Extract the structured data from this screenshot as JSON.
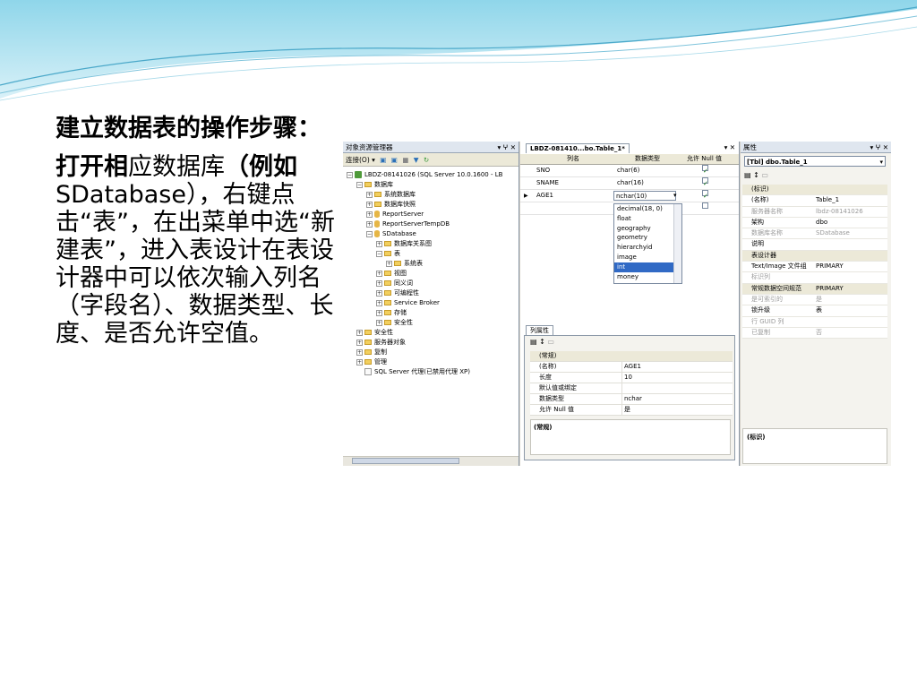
{
  "slide": {
    "heading": "建立数据表的操作步骤：",
    "body_bold_1": "打开相",
    "body_1": "应数据库",
    "body_bold_2": "（例如",
    "body_2": "SDatabase），右键点击“表”，在出菜单中选“新建表”，进入表设计在表设计器中可以依次输入列名（字段名）、数据类型、长度、是否允许空值。"
  },
  "object_explorer": {
    "title": "对象资源管理器",
    "controls": "▾ ⵖ ✕",
    "toolbar_connect": "连接(O) ▾",
    "tree": [
      {
        "label": "LBDZ-08141026 (SQL Server 10.0.1600 - LB",
        "level": 0,
        "pm": "−",
        "icon": "server"
      },
      {
        "label": "数据库",
        "level": 1,
        "pm": "−",
        "icon": "folder"
      },
      {
        "label": "系统数据库",
        "level": 2,
        "pm": "+",
        "icon": "folder"
      },
      {
        "label": "数据库快照",
        "level": 2,
        "pm": "+",
        "icon": "folder"
      },
      {
        "label": "ReportServer",
        "level": 2,
        "pm": "+",
        "icon": "db"
      },
      {
        "label": "ReportServerTempDB",
        "level": 2,
        "pm": "+",
        "icon": "db"
      },
      {
        "label": "SDatabase",
        "level": 2,
        "pm": "−",
        "icon": "db"
      },
      {
        "label": "数据库关系图",
        "level": 3,
        "pm": "+",
        "icon": "folder"
      },
      {
        "label": "表",
        "level": 3,
        "pm": "−",
        "icon": "folder"
      },
      {
        "label": "系统表",
        "level": 4,
        "pm": "+",
        "icon": "folder"
      },
      {
        "label": "视图",
        "level": 3,
        "pm": "+",
        "icon": "folder"
      },
      {
        "label": "同义词",
        "level": 3,
        "pm": "+",
        "icon": "folder"
      },
      {
        "label": "可编程性",
        "level": 3,
        "pm": "+",
        "icon": "folder"
      },
      {
        "label": "Service Broker",
        "level": 3,
        "pm": "+",
        "icon": "folder"
      },
      {
        "label": "存储",
        "level": 3,
        "pm": "+",
        "icon": "folder"
      },
      {
        "label": "安全性",
        "level": 3,
        "pm": "+",
        "icon": "folder"
      },
      {
        "label": "安全性",
        "level": 1,
        "pm": "+",
        "icon": "folder"
      },
      {
        "label": "服务器对象",
        "level": 1,
        "pm": "+",
        "icon": "folder"
      },
      {
        "label": "复制",
        "level": 1,
        "pm": "+",
        "icon": "folder"
      },
      {
        "label": "管理",
        "level": 1,
        "pm": "+",
        "icon": "folder"
      },
      {
        "label": "SQL Server 代理(已禁用代理 XP)",
        "level": 1,
        "pm": "",
        "icon": "agent"
      }
    ]
  },
  "designer": {
    "tab_label": "LBDZ-081410...bo.Table_1*",
    "controls": "▾ ✕",
    "headers": {
      "col_name": "列名",
      "data_type": "数据类型",
      "allow_null": "允许 Null 值"
    },
    "rows": [
      {
        "name": "SNO",
        "type": "char(6)",
        "nullable": true,
        "current": false
      },
      {
        "name": "SNAME",
        "type": "char(16)",
        "nullable": true,
        "current": false
      },
      {
        "name": "AGE1",
        "type": "nchar(10)",
        "nullable": true,
        "current": true
      }
    ],
    "type_options": [
      "decimal(18, 0)",
      "float",
      "geography",
      "geometry",
      "hierarchyid",
      "image",
      "int",
      "money"
    ],
    "selected_option": "int",
    "column_properties": {
      "title": "列属性",
      "rows": [
        {
          "k": "(常规)",
          "v": "",
          "cat": true
        },
        {
          "k": "(名称)",
          "v": "AGE1",
          "cat": false
        },
        {
          "k": "长度",
          "v": "10",
          "cat": false
        },
        {
          "k": "默认值或绑定",
          "v": "",
          "cat": false
        },
        {
          "k": "数据类型",
          "v": "nchar",
          "cat": false
        },
        {
          "k": "允许 Null 值",
          "v": "是",
          "cat": false
        }
      ],
      "desc": "(常规)"
    }
  },
  "properties": {
    "title": "属性",
    "controls": "▾ ⵖ ✕",
    "selector": "[Tbl] dbo.Table_1",
    "rows": [
      {
        "k": "(标识)",
        "v": "",
        "cat": true,
        "dim": false
      },
      {
        "k": "(名称)",
        "v": "Table_1",
        "cat": false,
        "dim": false
      },
      {
        "k": "服务器名称",
        "v": "lbdz-08141026",
        "cat": false,
        "dim": true
      },
      {
        "k": "架构",
        "v": "dbo",
        "cat": false,
        "dim": false
      },
      {
        "k": "数据库名称",
        "v": "SDatabase",
        "cat": false,
        "dim": true
      },
      {
        "k": "说明",
        "v": "",
        "cat": false,
        "dim": false
      },
      {
        "k": "表设计器",
        "v": "",
        "cat": true,
        "dim": false
      },
      {
        "k": "Text/Image 文件组",
        "v": "PRIMARY",
        "cat": false,
        "dim": false
      },
      {
        "k": "标识列",
        "v": "",
        "cat": false,
        "dim": true
      },
      {
        "k": "常规数据空间规范",
        "v": "PRIMARY",
        "cat": true,
        "dim": false
      },
      {
        "k": "是可索引的",
        "v": "是",
        "cat": false,
        "dim": true
      },
      {
        "k": "锁升级",
        "v": "表",
        "cat": false,
        "dim": false
      },
      {
        "k": "行 GUID 列",
        "v": "",
        "cat": false,
        "dim": true
      },
      {
        "k": "已复制",
        "v": "否",
        "cat": false,
        "dim": true
      }
    ],
    "desc": "(标识)"
  }
}
